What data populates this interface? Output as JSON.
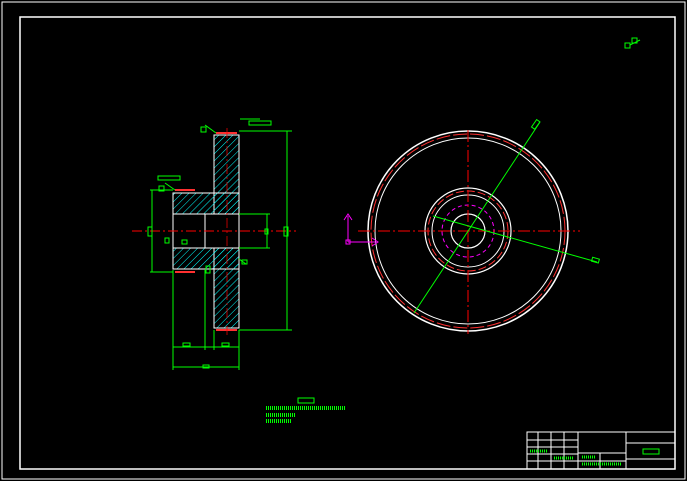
{
  "drawing": {
    "background": "#000000",
    "colors": {
      "frame": "#ffffff",
      "dimension": "#00ff00",
      "centerline": "#ff0000",
      "hatch": "#00ffff",
      "ucs": "#ff00ff",
      "outline": "#ffffff",
      "dash_circle": "#ff00ff"
    },
    "views": [
      "section-view",
      "front-view"
    ],
    "title_block": {
      "present": true
    },
    "technical_requirements": {
      "present": true
    }
  }
}
